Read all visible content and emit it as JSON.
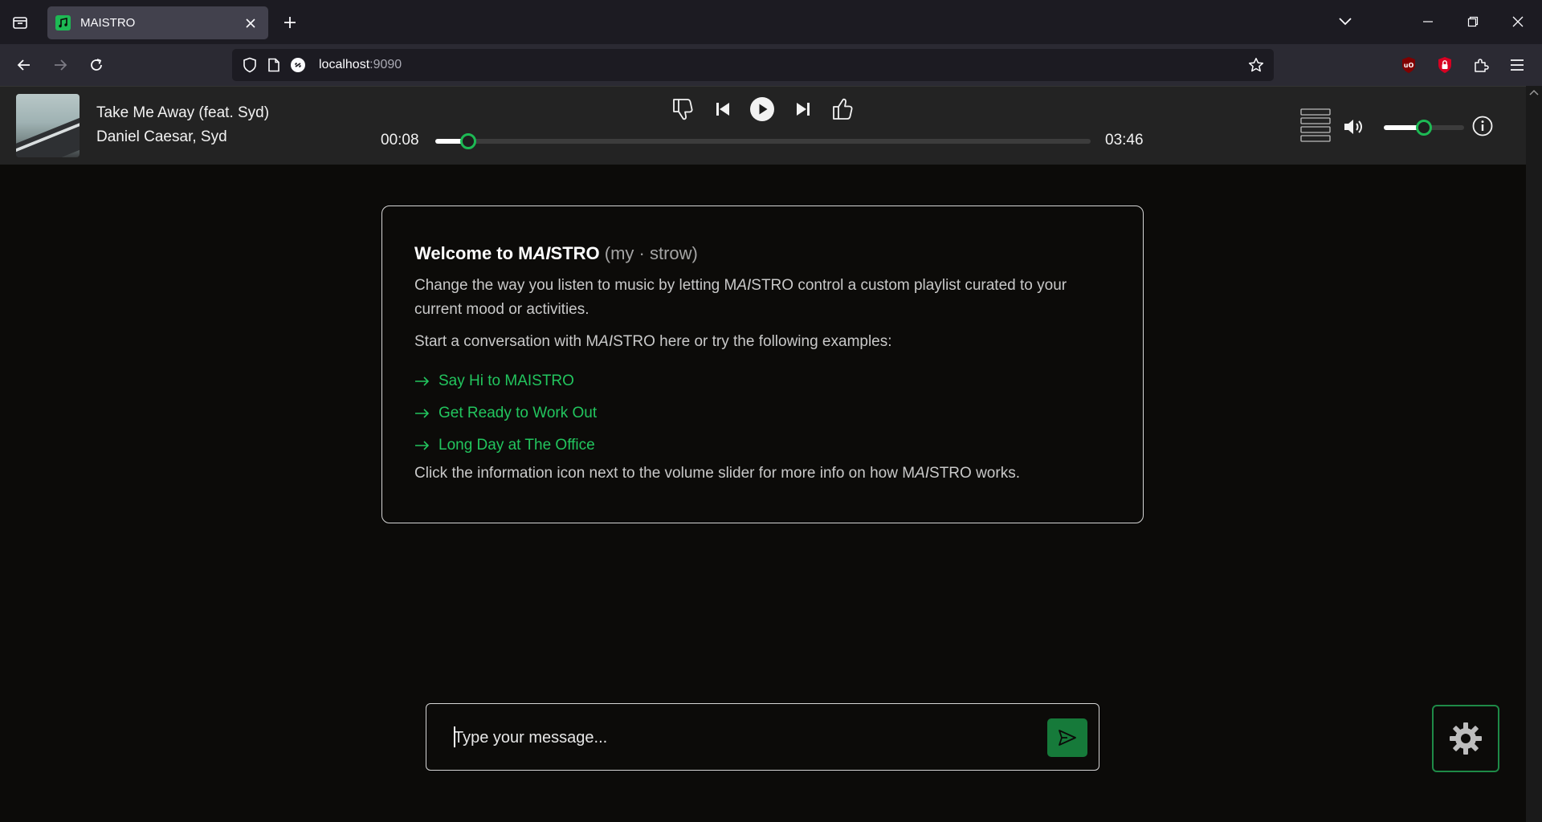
{
  "browser": {
    "tab_title": "MAISTRO",
    "url_host": "localhost",
    "url_port": ":9090"
  },
  "player": {
    "track_title": "Take Me Away (feat. Syd)",
    "artist": "Daniel Caesar, Syd",
    "elapsed": "00:08",
    "duration": "03:46",
    "progress_fraction": 0.05,
    "volume_fraction": 0.5
  },
  "welcome": {
    "title_main_pre": "Welcome to M",
    "title_main_ai": "AI",
    "title_main_post": "STRO",
    "title_pronunciation": "(my · strow)",
    "p1_pre": "Change the way you listen to music by letting M",
    "p1_ai": "AI",
    "p1_post": "STRO control a custom playlist curated to your current mood or activities.",
    "p2_pre": "Start a conversation with M",
    "p2_ai": "AI",
    "p2_post": "STRO here or try the following examples:",
    "examples": [
      "Say Hi to MAISTRO",
      "Get Ready to Work Out",
      "Long Day at The Office"
    ],
    "p3_pre": "Click the information icon next to the volume slider for more info on how M",
    "p3_ai": "AI",
    "p3_post": "STRO works."
  },
  "composer": {
    "placeholder": "Type your message...",
    "value": ""
  },
  "colors": {
    "accent": "#1db954",
    "link": "#22c55e",
    "send_button": "#167a3a",
    "background": "#0c0b09",
    "player_bg": "#232323"
  },
  "icons": [
    "tab-list-icon",
    "music-note-icon",
    "close-icon",
    "plus-icon",
    "chevron-down-icon",
    "minimize-icon",
    "restore-icon",
    "back-icon",
    "forward-icon",
    "reload-icon",
    "shield-icon",
    "page-icon",
    "connection-icon",
    "star-icon",
    "ublock-icon",
    "lock-extension-icon",
    "puzzle-icon",
    "menu-icon",
    "thumbs-down-icon",
    "previous-icon",
    "play-icon",
    "next-icon",
    "thumbs-up-icon",
    "queue-icon",
    "volume-icon",
    "info-icon",
    "arrow-right-icon",
    "send-icon",
    "gear-icon"
  ]
}
